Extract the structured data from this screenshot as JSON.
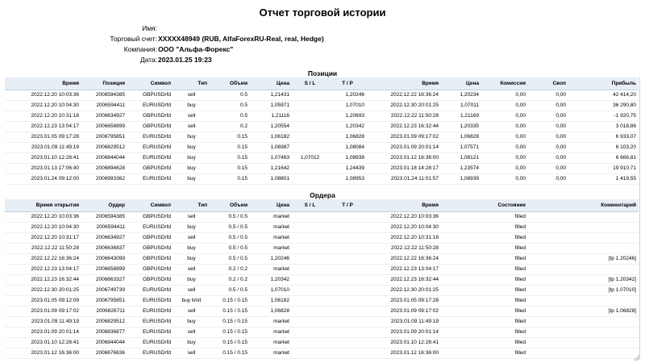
{
  "title": "Отчет торговой истории",
  "info": [
    {
      "label": "Имя:",
      "value": ""
    },
    {
      "label": "Торговый счет:",
      "value": "XXXXX48949 (RUB, AlfaForexRU-Real, real, Hedge)"
    },
    {
      "label": "Компания:",
      "value": "ООО \"Альфа-Форекс\""
    },
    {
      "label": "Дата:",
      "value": "2023.01.25 19:23"
    }
  ],
  "positions": {
    "section_title": "Позиции",
    "headers": [
      "Время",
      "Позиция",
      "Символ",
      "Тип",
      "Объем",
      "Цена",
      "S / L",
      "T / P",
      "Время",
      "Цена",
      "Комиссия",
      "Своп",
      "Прибыль"
    ],
    "rows": [
      [
        "2022.12.20 10:03:36",
        "2006594385",
        "GBPUSDrfd",
        "sell",
        "0.5",
        "1,21431",
        "",
        "1,20246",
        "2022.12.22 16:36:24",
        "1,20234",
        "0,00",
        "0,00",
        "42 414,20"
      ],
      [
        "2022.12.20 10:04:30",
        "2006594411",
        "EURUSDrfd",
        "buy",
        "0.5",
        "1,05971",
        "",
        "1,07010",
        "2022.12.30 20:01:25",
        "1,07011",
        "0,00",
        "0,00",
        "36 290,80"
      ],
      [
        "2022.12.20 10:31:18",
        "2006634927",
        "GBPUSDrfd",
        "sell",
        "0.5",
        "1,21116",
        "",
        "1,20693",
        "2022.12.22 11:50:28",
        "1,21169",
        "0,00",
        "0,00",
        "-1 920,75"
      ],
      [
        "2022.12.23 13:04:17",
        "2006658899",
        "GBPUSDrfd",
        "sell",
        "0.2",
        "1,20554",
        "",
        "1,20342",
        "2022.12.23 16:32:44",
        "1,20335",
        "0,00",
        "0,00",
        "3 018,86"
      ],
      [
        "2023.01.05 09:17:28",
        "2006795851",
        "EURUSDrfd",
        "buy",
        "0.15",
        "1,06182",
        "",
        "1,06828",
        "2023.01.09 09:17:02",
        "1,06828",
        "0,00",
        "0,00",
        "6 933,07"
      ],
      [
        "2023.01.09 11:49:19",
        "2006829512",
        "EURUSDrfd",
        "buy",
        "0.15",
        "1,06987",
        "",
        "1,08084",
        "2023.01.09 20:01:14",
        "1,07571",
        "0,00",
        "0,00",
        "6 103,20"
      ],
      [
        "2023.01.10 12:28:41",
        "2006844044",
        "EURUSDrfd",
        "buy",
        "0.15",
        "1,07463",
        "1,07012",
        "1,08938",
        "2023.01.12 16:36:00",
        "1,08121",
        "0,00",
        "0,00",
        "6 666,81"
      ],
      [
        "2023.01.13 17:06:40",
        "2006894628",
        "GBPUSDrfd",
        "buy",
        "0.15",
        "1,21642",
        "",
        "1,24439",
        "2023.01.18 14:28:17",
        "1,23574",
        "0,00",
        "0,00",
        "19 910,71"
      ],
      [
        "2023.01.24 09:12:00",
        "2006993362",
        "EURUSDrfd",
        "buy",
        "0.15",
        "1,08801",
        "",
        "1,08953",
        "2023.01.24 11:01:57",
        "1,08939",
        "0,00",
        "0,00",
        "1 419,55"
      ]
    ]
  },
  "orders": {
    "section_title": "Ордера",
    "headers": [
      "Время открытия",
      "Ордер",
      "Символ",
      "Тип",
      "Объем",
      "Цена",
      "S / L",
      "T / P",
      "Время",
      "Состояние",
      "Комментарий"
    ],
    "rows": [
      [
        "2022.12.20 10:03:36",
        "2006594385",
        "GBPUSDrfd",
        "sell",
        "0.5 / 0.5",
        "market",
        "",
        "",
        "2022.12.20 10:03:36",
        "filled",
        ""
      ],
      [
        "2022.12.20 10:04:30",
        "2006594411",
        "EURUSDrfd",
        "buy",
        "0.5 / 0.5",
        "market",
        "",
        "",
        "2022.12.20 10:04:30",
        "filled",
        ""
      ],
      [
        "2022.12.20 10:31:17",
        "2006634927",
        "GBPUSDrfd",
        "sell",
        "0.5 / 0.5",
        "market",
        "",
        "",
        "2022.12.20 10:31:18",
        "filled",
        ""
      ],
      [
        "2022.12.22 11:50:28",
        "2006636837",
        "GBPUSDrfd",
        "buy",
        "0.5 / 0.5",
        "market",
        "",
        "",
        "2022.12.22 11:50:28",
        "filled",
        ""
      ],
      [
        "2022.12.22 16:36:24",
        "2006643099",
        "GBPUSDrfd",
        "buy",
        "0.5 / 0.5",
        "1,20246",
        "",
        "",
        "2022.12.22 16:36:24",
        "filled",
        "[tp 1.20246]"
      ],
      [
        "2022.12.23 13:04:17",
        "2006658899",
        "GBPUSDrfd",
        "sell",
        "0.2 / 0.2",
        "market",
        "",
        "",
        "2022.12.23 13:04:17",
        "filled",
        ""
      ],
      [
        "2022.12.23 16:32:44",
        "2006663327",
        "GBPUSDrfd",
        "buy",
        "0.2 / 0.2",
        "1,20342",
        "",
        "",
        "2022.12.23 16:32:44",
        "filled",
        "[tp 1.20342]"
      ],
      [
        "2022.12.30 20:01:25",
        "2006749739",
        "EURUSDrfd",
        "sell",
        "0.5 / 0.5",
        "1,07010",
        "",
        "",
        "2022.12.30 20:01:25",
        "filled",
        "[tp 1.07010]"
      ],
      [
        "2023.01.05 09:12:09",
        "2006795851",
        "EURUSDrfd",
        "buy limit",
        "0.15 / 0.15",
        "1,06182",
        "",
        "",
        "2023.01.05 09:17:28",
        "filled",
        ""
      ],
      [
        "2023.01.09 09:17:02",
        "2006826711",
        "EURUSDrfd",
        "sell",
        "0.15 / 0.15",
        "1,06828",
        "",
        "",
        "2023.01.09 09:17:02",
        "filled",
        "[tp 1.06828]"
      ],
      [
        "2023.01.09 11:49:19",
        "2006829512",
        "EURUSDrfd",
        "buy",
        "0.15 / 0.15",
        "market",
        "",
        "",
        "2023.01.09 11:49:19",
        "filled",
        ""
      ],
      [
        "2023.01.09 20:01:14",
        "2006836877",
        "EURUSDrfd",
        "sell",
        "0.15 / 0.15",
        "market",
        "",
        "",
        "2023.01.09 20:01:14",
        "filled",
        ""
      ],
      [
        "2023.01.10 12:28:41",
        "2006844044",
        "EURUSDrfd",
        "buy",
        "0.15 / 0.15",
        "market",
        "",
        "",
        "2023.01.10 12:28:41",
        "filled",
        ""
      ],
      [
        "2023.01.12 16:36:00",
        "2006876636",
        "EURUSDrfd",
        "sell",
        "0.15 / 0.15",
        "market",
        "",
        "",
        "2023.01.12 16:36:00",
        "filled",
        ""
      ]
    ]
  }
}
